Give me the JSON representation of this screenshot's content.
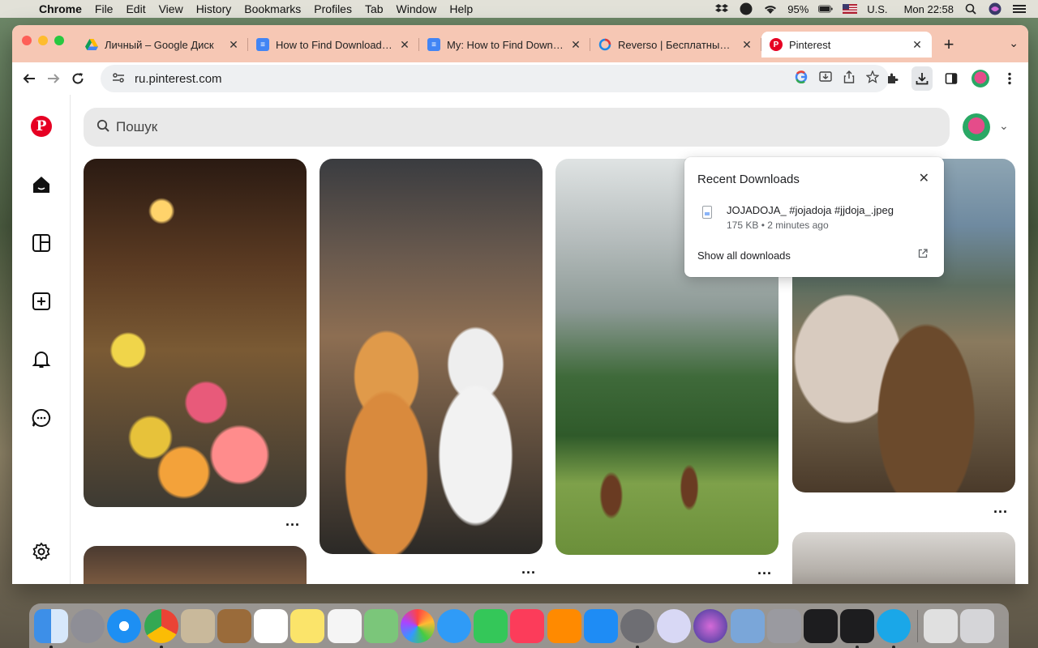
{
  "menubar": {
    "app_name": "Chrome",
    "menus": [
      "File",
      "Edit",
      "View",
      "History",
      "Bookmarks",
      "Profiles",
      "Tab",
      "Window",
      "Help"
    ],
    "battery": "95%",
    "input_source": "U.S.",
    "clock": "Mon 22:58"
  },
  "browser": {
    "tabs": [
      {
        "title": "Личный – Google Диск",
        "favicon": "google-drive-icon",
        "color": "#f4b400"
      },
      {
        "title": "How to Find Downloads on",
        "favicon": "google-docs-icon",
        "color": "#4285f4"
      },
      {
        "title": "My: How to Find Downloads",
        "favicon": "google-docs-icon",
        "color": "#4285f4"
      },
      {
        "title": "Reverso | Бесплатный пе",
        "favicon": "reverso-icon",
        "color": "#1e88e5"
      },
      {
        "title": "Pinterest",
        "favicon": "pinterest-icon",
        "color": "#e60023"
      }
    ],
    "url": "ru.pinterest.com"
  },
  "pinterest": {
    "search_placeholder": "Пошук",
    "more_label": "..."
  },
  "downloads_popup": {
    "title": "Recent Downloads",
    "file_name": "JOJADOJA_ #jojadoja #jjdoja_.jpeg",
    "file_meta": "175 KB • 2 minutes ago",
    "show_all": "Show all downloads"
  },
  "colors": {
    "pinterest_red": "#e60023",
    "tabstrip": "#f6c7b4"
  }
}
